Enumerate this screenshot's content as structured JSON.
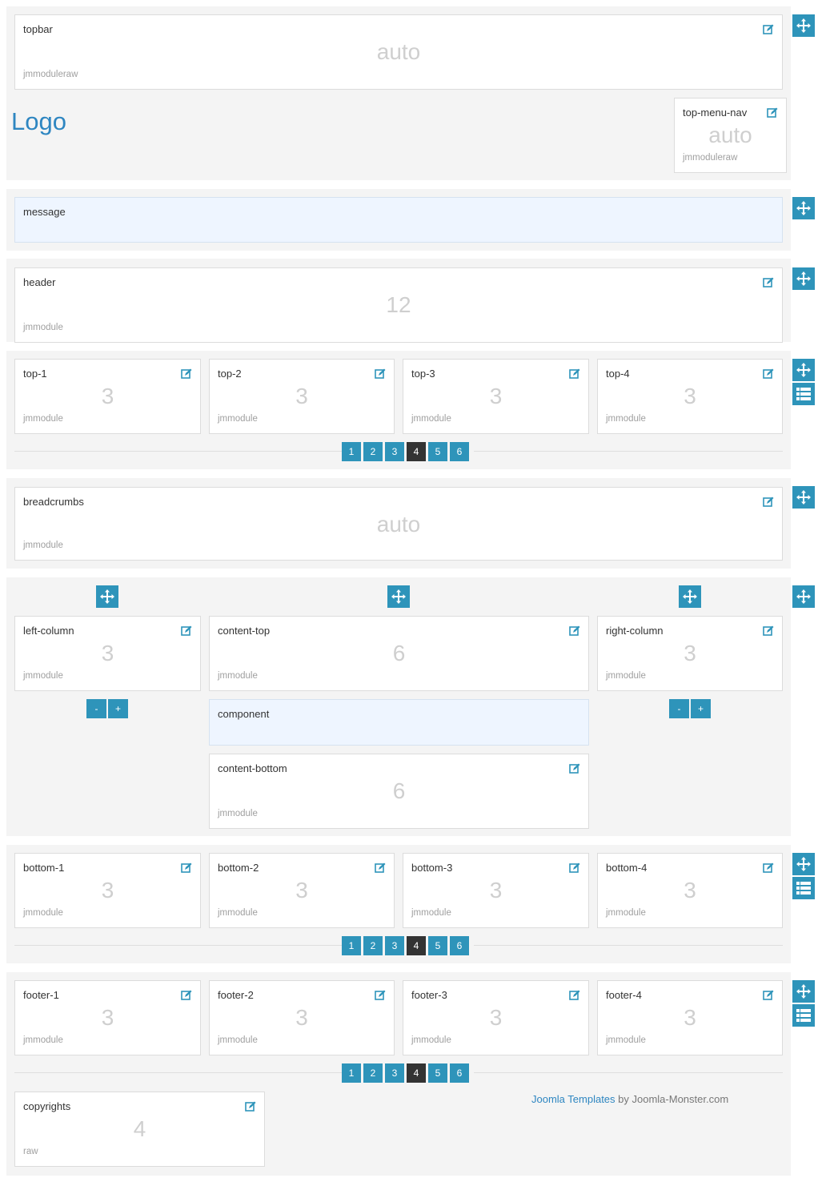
{
  "colors": {
    "accent": "#2e94ba",
    "active_page": "#333333",
    "message_bg": "#eef5ff",
    "row_bg": "#f4f4f4"
  },
  "icons": {
    "edit": "edit-icon",
    "move": "move-arrows-icon",
    "list": "list-icon"
  },
  "logo": "Logo",
  "topbar": {
    "name": "topbar",
    "size": "auto",
    "type": "jmmoduleraw"
  },
  "top_menu_nav": {
    "name": "top-menu-nav",
    "size": "auto",
    "type": "jmmoduleraw"
  },
  "message": {
    "name": "message"
  },
  "header": {
    "name": "header",
    "size": "12",
    "type": "jmmodule"
  },
  "top_row": [
    {
      "name": "top-1",
      "size": "3",
      "type": "jmmodule"
    },
    {
      "name": "top-2",
      "size": "3",
      "type": "jmmodule"
    },
    {
      "name": "top-3",
      "size": "3",
      "type": "jmmodule"
    },
    {
      "name": "top-4",
      "size": "3",
      "type": "jmmodule"
    }
  ],
  "pagination": {
    "pages": [
      "1",
      "2",
      "3",
      "4",
      "5",
      "6"
    ],
    "active": "4"
  },
  "breadcrumbs": {
    "name": "breadcrumbs",
    "size": "auto",
    "type": "jmmodule"
  },
  "main": {
    "left_column": {
      "name": "left-column",
      "size": "3",
      "type": "jmmodule"
    },
    "content_top": {
      "name": "content-top",
      "size": "6",
      "type": "jmmodule"
    },
    "right_column": {
      "name": "right-column",
      "size": "3",
      "type": "jmmodule"
    },
    "component": {
      "name": "component"
    },
    "content_bottom": {
      "name": "content-bottom",
      "size": "6",
      "type": "jmmodule"
    },
    "stepper": {
      "minus": "-",
      "plus": "+"
    }
  },
  "bottom_row": [
    {
      "name": "bottom-1",
      "size": "3",
      "type": "jmmodule"
    },
    {
      "name": "bottom-2",
      "size": "3",
      "type": "jmmodule"
    },
    {
      "name": "bottom-3",
      "size": "3",
      "type": "jmmodule"
    },
    {
      "name": "bottom-4",
      "size": "3",
      "type": "jmmodule"
    }
  ],
  "footer_row": [
    {
      "name": "footer-1",
      "size": "3",
      "type": "jmmodule"
    },
    {
      "name": "footer-2",
      "size": "3",
      "type": "jmmodule"
    },
    {
      "name": "footer-3",
      "size": "3",
      "type": "jmmodule"
    },
    {
      "name": "footer-4",
      "size": "3",
      "type": "jmmodule"
    }
  ],
  "copyrights": {
    "name": "copyrights",
    "size": "4",
    "type": "raw"
  },
  "credit": {
    "link": "Joomla Templates",
    "text": " by Joomla-Monster.com"
  }
}
